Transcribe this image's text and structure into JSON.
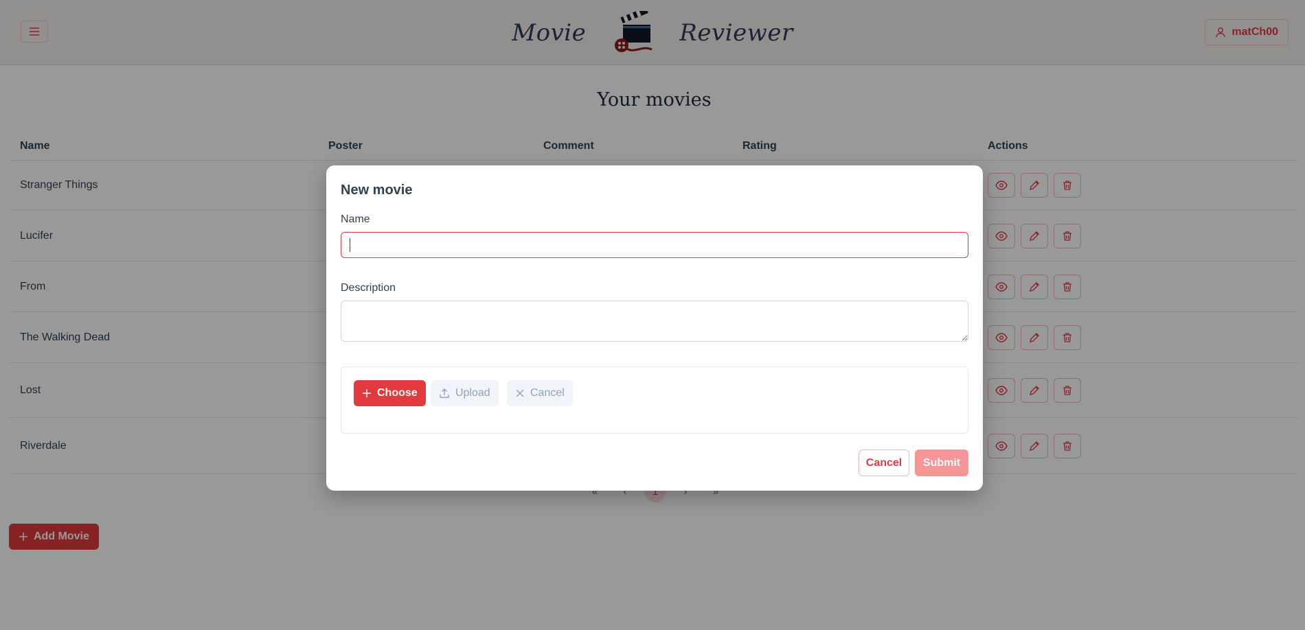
{
  "header": {
    "brand_left": "Movie",
    "brand_right": "Reviewer",
    "user_label": "matCh00"
  },
  "page": {
    "title": "Your movies"
  },
  "table": {
    "columns": [
      "Name",
      "Poster",
      "Comment",
      "Rating",
      "Actions"
    ],
    "rows": [
      {
        "name": "Stranger Things"
      },
      {
        "name": "Lucifer"
      },
      {
        "name": "From"
      },
      {
        "name": "The Walking Dead"
      },
      {
        "name": "Lost"
      },
      {
        "name": "Riverdale"
      }
    ]
  },
  "pagination": {
    "first": "«",
    "prev": "‹",
    "current": "1",
    "next": "›",
    "last": "»"
  },
  "add_button_label": "Add Movie",
  "dialog": {
    "title": "New movie",
    "name_label": "Name",
    "name_value": "",
    "description_label": "Description",
    "description_value": "",
    "choose_label": "Choose",
    "upload_label": "Upload",
    "upload_cancel_label": "Cancel",
    "cancel_label": "Cancel",
    "submit_label": "Submit"
  },
  "colors": {
    "accent": "#e23a3f",
    "header_bg": "#f3eeee",
    "brand_text": "#2f3b59"
  }
}
